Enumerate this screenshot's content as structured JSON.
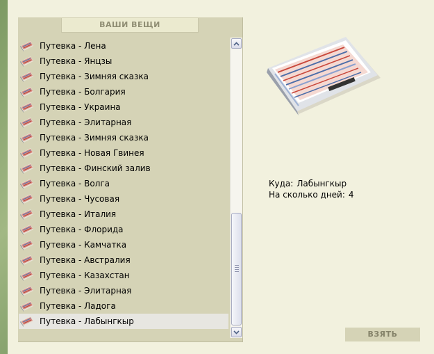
{
  "panel": {
    "title": "ВАШИ ВЕЩИ",
    "items": [
      "Путевка - Лена",
      "Путевка - Янцзы",
      "Путевка - Зимняя сказка",
      "Путевка - Болгария",
      "Путевка - Украина",
      "Путевка - Элитарная",
      "Путевка - Зимняя сказка",
      "Путевка - Новая Гвинея",
      "Путевка - Финский залив",
      "Путевка - Волга",
      "Путевка - Чусовая",
      "Путевка - Италия",
      "Путевка - Флорида",
      "Путевка - Камчатка",
      "Путевка - Австралия",
      "Путевка - Казахстан",
      "Путевка - Элитарная",
      "Путевка - Ладога",
      "Путевка - Лабынгкыр"
    ],
    "selected_index": 18,
    "item_icon": "ticket-icon"
  },
  "details": {
    "destination_label": "Куда:",
    "destination_value": "Лабынгкыр",
    "days_label": "На сколько дней:",
    "days_value": "4"
  },
  "actions": {
    "take_label": "ВЗЯТЬ"
  },
  "colors": {
    "window_bg": "#f2f1de",
    "panel_bg": "#d5d3b6",
    "selected_row": "#e7e6e1",
    "button_text": "#85836a"
  }
}
